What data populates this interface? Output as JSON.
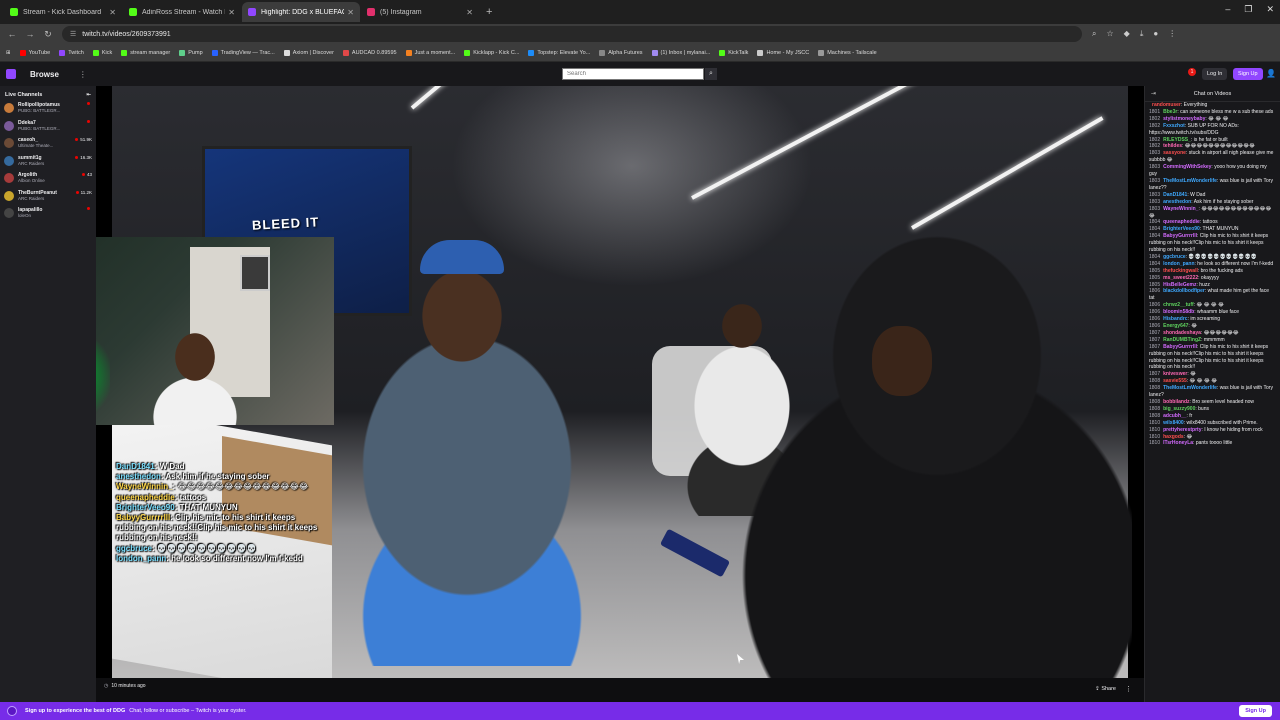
{
  "browser": {
    "tabs": [
      {
        "title": "Stream - Kick Dashboard",
        "color": "#53fc18"
      },
      {
        "title": "AdinRoss Stream - Watch Live ...",
        "color": "#53fc18"
      },
      {
        "title": "Highlight: DDG x BLUEFACE ...",
        "color": "#9147ff",
        "active": true
      },
      {
        "title": "(5) Instagram",
        "color": "#e1306c"
      }
    ],
    "url": "twitch.tv/videos/2609373991",
    "bookmarks": [
      {
        "label": "YouTube",
        "color": "#ff0000"
      },
      {
        "label": "Twitch",
        "color": "#9147ff"
      },
      {
        "label": "Kick",
        "color": "#53fc18"
      },
      {
        "label": "stream manager",
        "color": "#53fc18"
      },
      {
        "label": "Pump",
        "color": "#5fcf8b"
      },
      {
        "label": "TradingView — Trac...",
        "color": "#2962ff"
      },
      {
        "label": "Axiom | Discover",
        "color": "#dddddd"
      },
      {
        "label": "AUDCAD 0.89595",
        "color": "#e04848"
      },
      {
        "label": "Just a moment...",
        "color": "#f48120"
      },
      {
        "label": "Kicklapp - Kick C...",
        "color": "#53fc18"
      },
      {
        "label": "Topstep: Elevate Yo...",
        "color": "#1d8cf8"
      },
      {
        "label": "Alpha Futures",
        "color": "#888888"
      },
      {
        "label": "(1) Inbox | mylanai...",
        "color": "#a08af0"
      },
      {
        "label": "KickTalk",
        "color": "#53fc18"
      },
      {
        "label": "Home - My JSCC",
        "color": "#cccccc"
      },
      {
        "label": "Machines - Tailscale",
        "color": "#999999"
      }
    ]
  },
  "twitch": {
    "browse_label": "Browse",
    "search_placeholder": "Search",
    "notif_count": "1",
    "login_label": "Log In",
    "signup_label": "Sign Up"
  },
  "sidebar": {
    "heading": "Live Channels",
    "channels": [
      {
        "name": "Rollipollipotamus",
        "game": "PUBG: BATTLEGR...",
        "viewers": "",
        "color": "#c87b3b"
      },
      {
        "name": "Ddeka7",
        "game": "PUBG: BATTLEGR...",
        "viewers": "",
        "color": "#7a5a9a"
      },
      {
        "name": "caseoh_",
        "game": "Ultimate Theate...",
        "viewers": "51.9K",
        "color": "#6b4a36"
      },
      {
        "name": "summit1g",
        "game": "ARC Raiders",
        "viewers": "16.3K",
        "color": "#356a9e"
      },
      {
        "name": "Argolith",
        "game": "Albion Online",
        "viewers": "43",
        "color": "#a63b3b"
      },
      {
        "name": "TheBurntPeanut",
        "game": "ARC Raiders",
        "viewers": "11.2K",
        "color": "#c9a52c"
      },
      {
        "name": "lapapalillo",
        "game": "loleOn",
        "viewers": "",
        "color": "#444444"
      }
    ]
  },
  "player": {
    "poster_text": "BLEED IT",
    "overlay_chat": [
      {
        "user": "DanD1841",
        "text": ": W Dad",
        "cls": "u"
      },
      {
        "user": "anesthedon",
        "text": ": Ask him if he staying sober",
        "cls": "u"
      },
      {
        "user": "WayneWinnin_",
        "text": ": 😂😂😂😂😂😂😂😂😂😂😂😂😂😂",
        "cls": "ue"
      },
      {
        "user": "queenapheddie",
        "text": ": tattoos",
        "cls": "ue"
      },
      {
        "user": "BrighterVeeo90",
        "text": ": THAT MUNYUN",
        "cls": "u"
      },
      {
        "user": "BabyyGurrrrlll",
        "text": ": Clip his mic to his shirt it keeps rubbing on his neck!!Clip his mic to his shirt it keeps rubbing on his neck!!",
        "cls": "ue"
      },
      {
        "user": "ggcbruce",
        "text": ": 💀💀💀💀💀💀💀💀💀💀",
        "cls": "u"
      },
      {
        "user": "london_pann",
        "text": ": he look so different now I'm f-kedd",
        "cls": "u"
      }
    ],
    "time_ago": "10 minutes ago",
    "share_label": "Share"
  },
  "chat": {
    "heading": "Chat on Videos",
    "messages": [
      {
        "ts": "",
        "name": "randomuser",
        "color": "#ff4f4f",
        "text": ": Everything"
      },
      {
        "ts": "1801",
        "name": "Bbe3r",
        "color": "#5fd35f",
        "text": ": can someone bless me w a sub these ads"
      },
      {
        "ts": "1802",
        "name": "stylistmoneybaby",
        "color": "#d36bff",
        "text": ": 😂 😂 😂"
      },
      {
        "ts": "1802",
        "name": "Fxxszhot",
        "color": "#3fa9ff",
        "text": ": SUB UP FOR NO ADs: https://www.twitch.tv/subs/DDG"
      },
      {
        "ts": "1802",
        "name": "RILEYDSS_",
        "color": "#5fd35f",
        "text": ": is he fat or built"
      },
      {
        "ts": "1802",
        "name": "tehildes",
        "color": "#ff69b4",
        "text": ": 😂😂😂😂😂😂😂😂😂😂😂😂"
      },
      {
        "ts": "1803",
        "name": "sassyone",
        "color": "#ff4f4f",
        "text": ": stuck in airport all nigh please give me subbbb 😂"
      },
      {
        "ts": "1803",
        "name": "CommingWithSekey",
        "color": "#d36bff",
        "text": ": yooo how you doing my guy"
      },
      {
        "ts": "1803",
        "name": "TheMostLmWonderlife",
        "color": "#3fa9ff",
        "text": ": was blue is jail with Tory lanez??"
      },
      {
        "ts": "1803",
        "name": "DanD1841",
        "color": "#3fa9ff",
        "text": ": W Dad"
      },
      {
        "ts": "1803",
        "name": "anesthedon",
        "color": "#3fa9ff",
        "text": ": Ask him if he staying sober"
      },
      {
        "ts": "1803",
        "name": "WayneWinnin_",
        "color": "#d36bff",
        "text": ": 😂😂😂😂😂😂😂😂😂😂😂😂😂"
      },
      {
        "ts": "1804",
        "name": "queenapheddie",
        "color": "#d36bff",
        "text": ": tattoos"
      },
      {
        "ts": "1804",
        "name": "BrighterVeeo90",
        "color": "#3fa9ff",
        "text": ": THAT MUNYUN"
      },
      {
        "ts": "1804",
        "name": "BabyyGurrrrlll",
        "color": "#d36bff",
        "text": ": Clip his mic to his shirt it keeps rubbing on his neck!!Clip his mic to his shirt it keeps rubbing on his neck!!"
      },
      {
        "ts": "1804",
        "name": "ggcbruce",
        "color": "#3fa9ff",
        "text": ": 💀💀💀💀💀💀💀💀💀💀💀"
      },
      {
        "ts": "1804",
        "name": "london_pann",
        "color": "#3fa9ff",
        "text": ": he look so different now I'm f-kedd"
      },
      {
        "ts": "1805",
        "name": "thefuckingwall",
        "color": "#ff4f4f",
        "text": ": bro the fucking ads"
      },
      {
        "ts": "1805",
        "name": "ms_sweet2222",
        "color": "#ff69b4",
        "text": ": okayyyy"
      },
      {
        "ts": "1805",
        "name": "HisBelleGemz",
        "color": "#d36bff",
        "text": ": huzz"
      },
      {
        "ts": "1806",
        "name": "blackdollbodfiper",
        "color": "#3fa9ff",
        "text": ": what made him get the face tat"
      },
      {
        "ts": "1806",
        "name": "chrwz2__tuff",
        "color": "#5fd35f",
        "text": ": 😂 😂 😂 😂"
      },
      {
        "ts": "1806",
        "name": "bloomin58db",
        "color": "#d36bff",
        "text": ": whaamm blue face"
      },
      {
        "ts": "1806",
        "name": "Hisbandrc",
        "color": "#3fa9ff",
        "text": ": im screaming"
      },
      {
        "ts": "1806",
        "name": "Energy647",
        "color": "#5fd35f",
        "text": ": 😂"
      },
      {
        "ts": "1807",
        "name": "shondadeshaya",
        "color": "#ff69b4",
        "text": ": 😂😂😂😂😂😂"
      },
      {
        "ts": "1807",
        "name": "RanDUMBTingZ",
        "color": "#5fd35f",
        "text": ": mmmmm"
      },
      {
        "ts": "1807",
        "name": "BabyyGurrrrlll",
        "color": "#d36bff",
        "text": ": Clip his mic to his shirt it keeps rubbing on his neck!!Clip his mic to his shirt it keeps rubbing on his neck!!Clip his mic to his shirt it keeps rubbing on his neck!!"
      },
      {
        "ts": "1807",
        "name": "kniveswer",
        "color": "#ff69b4",
        "text": ": 😂"
      },
      {
        "ts": "1808",
        "name": "sasvie555",
        "color": "#ff4f4f",
        "text": ": 😂 😂 😂 😂"
      },
      {
        "ts": "1808",
        "name": "TheMostLmWonderlife",
        "color": "#3fa9ff",
        "text": ": was blue is jail with Tory lanez?"
      },
      {
        "ts": "1808",
        "name": "bobbilandz",
        "color": "#ff69b4",
        "text": ": Bro seem level headed now"
      },
      {
        "ts": "1808",
        "name": "big_suzzy900",
        "color": "#5fd35f",
        "text": ": buns"
      },
      {
        "ts": "1808",
        "name": "adcubh__",
        "color": "#d36bff",
        "text": ": fr"
      },
      {
        "ts": "1810",
        "name": "wilx8400",
        "color": "#3fa9ff",
        "text": ": wilx8400 subscribed with Prime."
      },
      {
        "ts": "1810",
        "name": "prettyherestprty",
        "color": "#d36bff",
        "text": ": I know he hiding from rock"
      },
      {
        "ts": "1810",
        "name": "haxgods",
        "color": "#ff4f4f",
        "text": ": 😂"
      },
      {
        "ts": "1810",
        "name": "ITsrHoneyLa",
        "color": "#d36bff",
        "text": ": pants toooo little"
      }
    ]
  },
  "banner": {
    "bold_text": "Sign up to experience the best of DDG",
    "text": "Chat, follow or subscribe – Twitch is your oyster.",
    "signup_label": "Sign Up"
  }
}
